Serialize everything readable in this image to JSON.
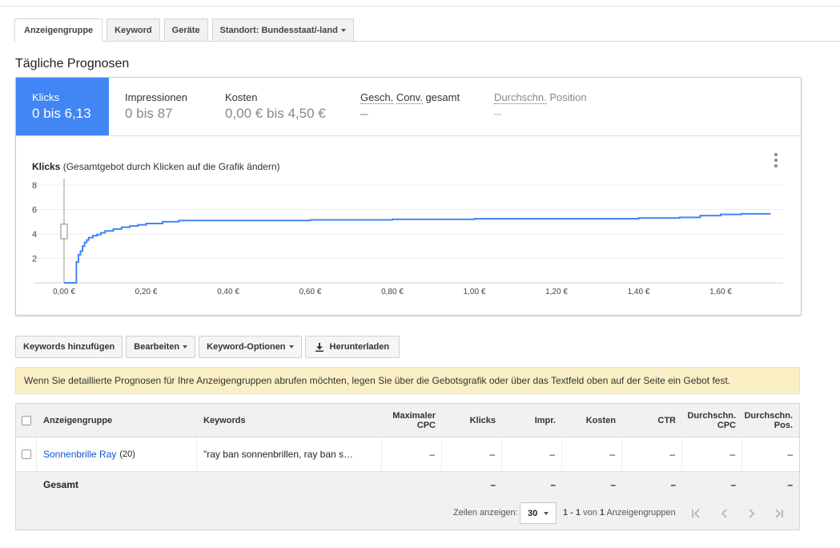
{
  "tabs": [
    {
      "label": "Anzeigengruppe",
      "active": true
    },
    {
      "label": "Keyword"
    },
    {
      "label": "Geräte"
    },
    {
      "label": "Standort: Bundesstaat/-land"
    }
  ],
  "section_title": "Tägliche Prognosen",
  "metrics": [
    {
      "label": "Klicks",
      "value": "0 bis 6,13"
    },
    {
      "label": "Impressionen",
      "value": "0 bis 87"
    },
    {
      "label": "Kosten",
      "value": "0,00 € bis 4,50 €"
    },
    {
      "label_part1": "Gesch.",
      "label_part2": "Conv.",
      "label_part3": "gesamt",
      "value": "–"
    },
    {
      "label_part1": "Durchschn.",
      "label_part2": "Position",
      "value": "–"
    }
  ],
  "chart": {
    "title_bold": "Klicks",
    "title_rest": "(Gesamtgebot durch Klicken auf die Grafik ändern)"
  },
  "chart_data": {
    "type": "line",
    "title": "Klicks (Gesamtgebot durch Klicken auf die Grafik ändern)",
    "xlabel": "",
    "ylabel": "",
    "xlim": [
      0,
      1.72
    ],
    "ylim": [
      0,
      8
    ],
    "x_ticks": [
      0,
      0.2,
      0.4,
      0.6,
      0.8,
      1.0,
      1.2,
      1.4,
      1.6
    ],
    "x_tick_labels": [
      "0,00 €",
      "0,20 €",
      "0,40 €",
      "0,60 €",
      "0,80 €",
      "1,00 €",
      "1,20 €",
      "1,40 €",
      "1,60 €"
    ],
    "y_ticks": [
      2,
      4,
      6,
      8
    ],
    "y_tick_labels": [
      "2",
      "4",
      "6",
      "8"
    ],
    "grid": true,
    "series": [
      {
        "color": "#4285f4",
        "step": true,
        "x": [
          0.0,
          0.03,
          0.035,
          0.04,
          0.045,
          0.05,
          0.055,
          0.06,
          0.07,
          0.08,
          0.09,
          0.1,
          0.12,
          0.14,
          0.16,
          0.18,
          0.2,
          0.24,
          0.28,
          0.4,
          0.6,
          0.8,
          1.0,
          1.2,
          1.4,
          1.5,
          1.55,
          1.6,
          1.65,
          1.72
        ],
        "y": [
          0.0,
          1.7,
          2.3,
          2.6,
          3.0,
          3.3,
          3.5,
          3.7,
          3.85,
          3.95,
          4.1,
          4.25,
          4.4,
          4.55,
          4.65,
          4.75,
          4.85,
          5.0,
          5.1,
          5.1,
          5.15,
          5.2,
          5.25,
          5.25,
          5.3,
          5.35,
          5.5,
          5.6,
          5.65,
          5.7
        ]
      }
    ],
    "marker_bid_x": 0.0
  },
  "toolbar": {
    "add_keywords": "Keywords hinzufügen",
    "edit": "Bearbeiten",
    "keyword_options": "Keyword-Optionen",
    "download": "Herunterladen"
  },
  "notice": "Wenn Sie detaillierte Prognosen für Ihre Anzeigengruppen abrufen möchten, legen Sie über die Gebotsgrafik oder über das Textfeld oben auf der Seite ein Gebot fest.",
  "table": {
    "headers": {
      "group": "Anzeigengruppe",
      "keywords": "Keywords",
      "max_cpc_1": "Maximaler",
      "max_cpc_2": "CPC",
      "clicks": "Klicks",
      "impr": "Impr.",
      "costs": "Kosten",
      "ctr": "CTR",
      "avg_cpc_1": "Durchschn.",
      "avg_cpc_2": "CPC",
      "avg_pos_1": "Durchschn.",
      "avg_pos_2": "Pos."
    },
    "rows": [
      {
        "group": "Sonnenbrille Ray",
        "count": "(20)",
        "keywords": "\"ray ban sonnenbrillen, ray ban s…",
        "values": [
          "–",
          "–",
          "–",
          "–",
          "–",
          "–",
          "–"
        ]
      }
    ],
    "total": {
      "label": "Gesamt",
      "values": [
        "",
        "–",
        "–",
        "–",
        "–",
        "–",
        "–"
      ]
    }
  },
  "paging": {
    "rows_label": "Zeilen anzeigen:",
    "rows_value": "30",
    "range": "1 - 1",
    "of_text": "von",
    "total": "1",
    "unit": "Anzeigengruppen"
  }
}
